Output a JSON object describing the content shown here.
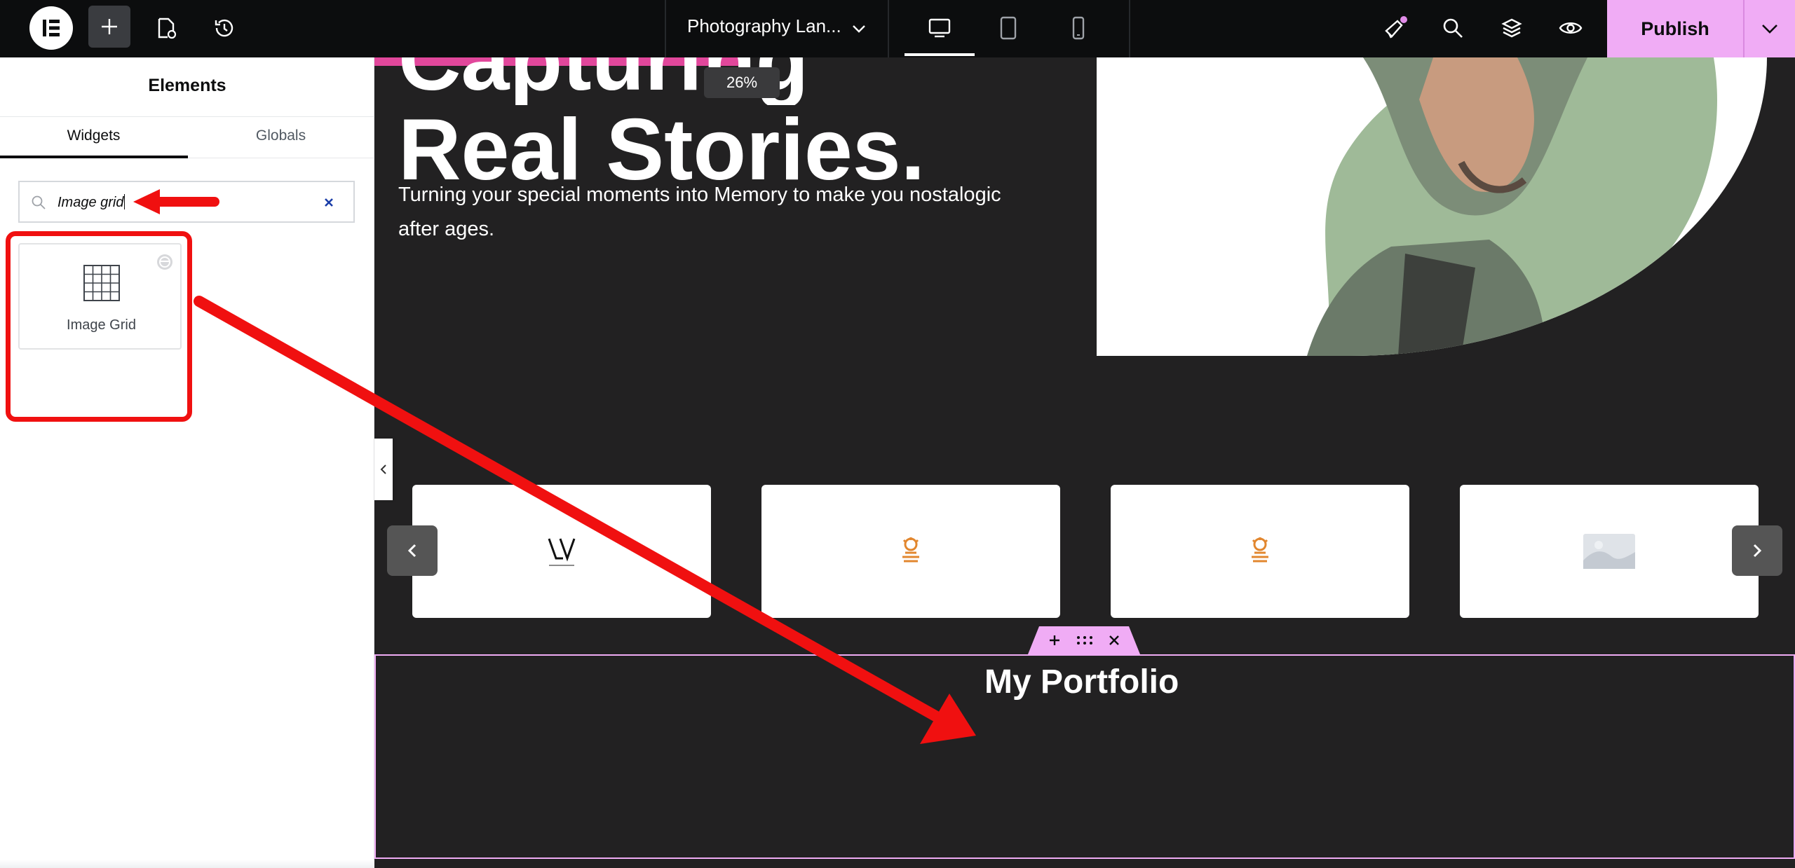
{
  "topbar": {
    "document_title": "Photography Lan...",
    "publish_label": "Publish"
  },
  "panel": {
    "title": "Elements",
    "tabs": [
      {
        "label": "Widgets",
        "active": true
      },
      {
        "label": "Globals",
        "active": false
      }
    ],
    "search": {
      "value": "Image grid"
    },
    "widget": {
      "label": "Image Grid"
    }
  },
  "canvas": {
    "zoom": "26%",
    "hero_title": "Capturing Real Stories.",
    "hero_title_visible_line": "Real Stories.",
    "hero_subtitle": "Turning your special moments into Memory to make you nostalogic after ages.",
    "carousel": {
      "logos": [
        "LV",
        "BRAND",
        "BRAND",
        "placeholder"
      ]
    },
    "section_heading": "My Portfolio"
  },
  "colors": {
    "topbar_bg": "#0c0d0e",
    "accent_pink": "#f0acf5",
    "canvas_bg": "#222122",
    "annotation_red": "#f01010"
  },
  "icons": [
    "elementor-logo-icon",
    "plus-icon",
    "page-settings-icon",
    "history-icon",
    "chevron-down-icon",
    "desktop-icon",
    "tablet-icon",
    "mobile-icon",
    "announcements-icon",
    "search-icon",
    "layers-icon",
    "eye-icon",
    "grid-icon",
    "pro-badge-icon",
    "clear-icon",
    "chevron-left-icon",
    "chevron-right-icon",
    "move-icon",
    "close-icon"
  ]
}
